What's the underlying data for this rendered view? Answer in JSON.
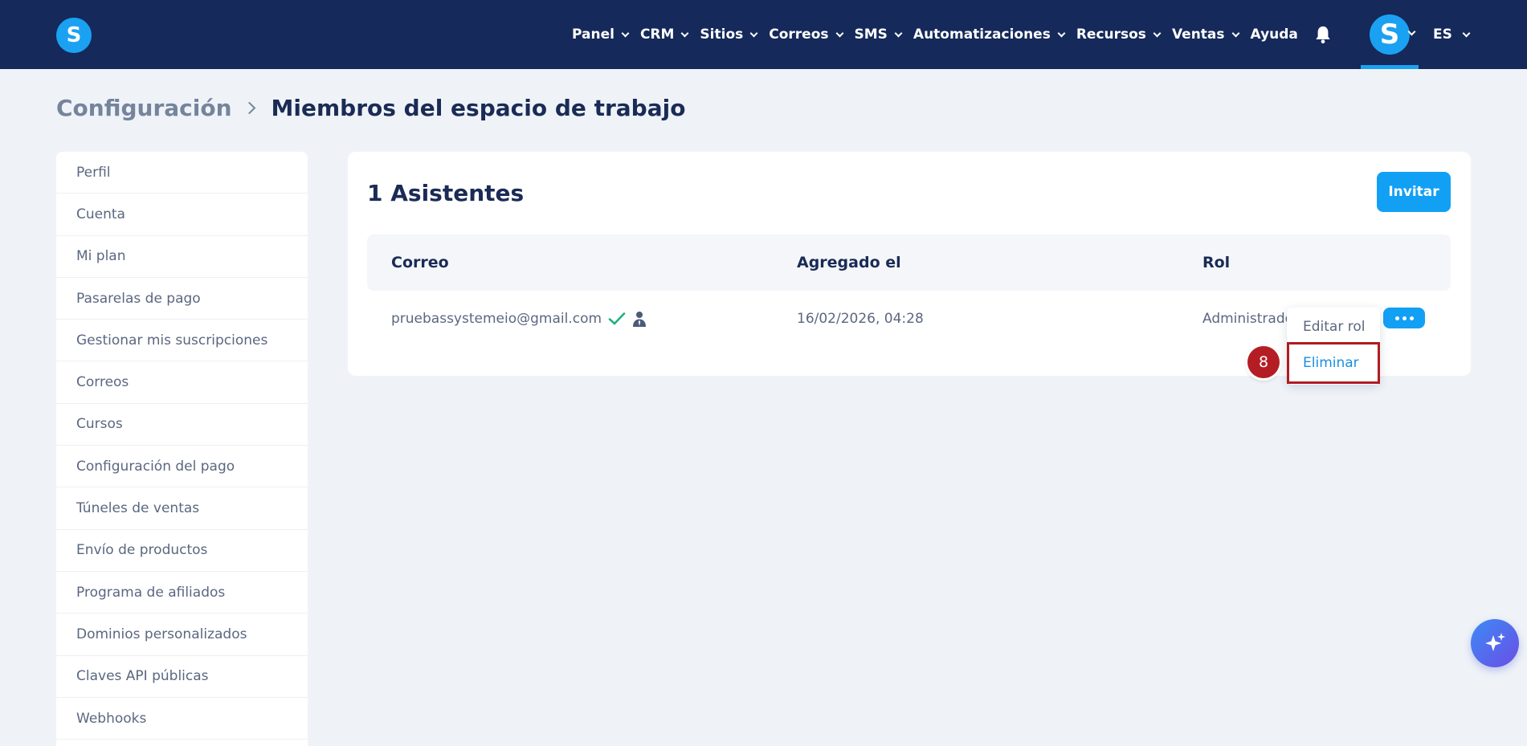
{
  "brand": {
    "logo_letter": "S",
    "accent": "#1ba1f2",
    "nav_bg": "#15295a"
  },
  "nav": {
    "items": [
      {
        "label": "Panel"
      },
      {
        "label": "CRM"
      },
      {
        "label": "Sitios"
      },
      {
        "label": "Correos"
      },
      {
        "label": "SMS"
      },
      {
        "label": "Automatizaciones"
      },
      {
        "label": "Recursos"
      },
      {
        "label": "Ventas"
      }
    ],
    "help": "Ayuda",
    "avatar_letter": "S",
    "language": "ES"
  },
  "breadcrumb": {
    "parent": "Configuración",
    "current": "Miembros del espacio de trabajo"
  },
  "sidebar": {
    "items": [
      {
        "label": "Perfil"
      },
      {
        "label": "Cuenta"
      },
      {
        "label": "Mi plan"
      },
      {
        "label": "Pasarelas de pago"
      },
      {
        "label": "Gestionar mis suscripciones"
      },
      {
        "label": "Correos"
      },
      {
        "label": "Cursos"
      },
      {
        "label": "Configuración del pago"
      },
      {
        "label": "Túneles de ventas"
      },
      {
        "label": "Envío de productos"
      },
      {
        "label": "Programa de afiliados"
      },
      {
        "label": "Dominios personalizados"
      },
      {
        "label": "Claves API públicas"
      },
      {
        "label": "Webhooks"
      }
    ]
  },
  "main": {
    "title": "1 Asistentes",
    "invite_label": "Invitar",
    "table": {
      "headers": {
        "email": "Correo",
        "added": "Agregado el",
        "role": "Rol"
      },
      "rows": [
        {
          "email": "pruebassystemeio@gmail.com",
          "added": "16/02/2026, 04:28",
          "role": "Administrador"
        }
      ]
    },
    "dropdown": {
      "edit": "Editar rol",
      "delete": "Eliminar"
    },
    "step_badge": "8"
  },
  "icons": {
    "bell": "bell-icon",
    "verified": "check-icon",
    "user": "user-icon",
    "more": "more-horizontal-icon",
    "ai": "sparkles-icon"
  }
}
